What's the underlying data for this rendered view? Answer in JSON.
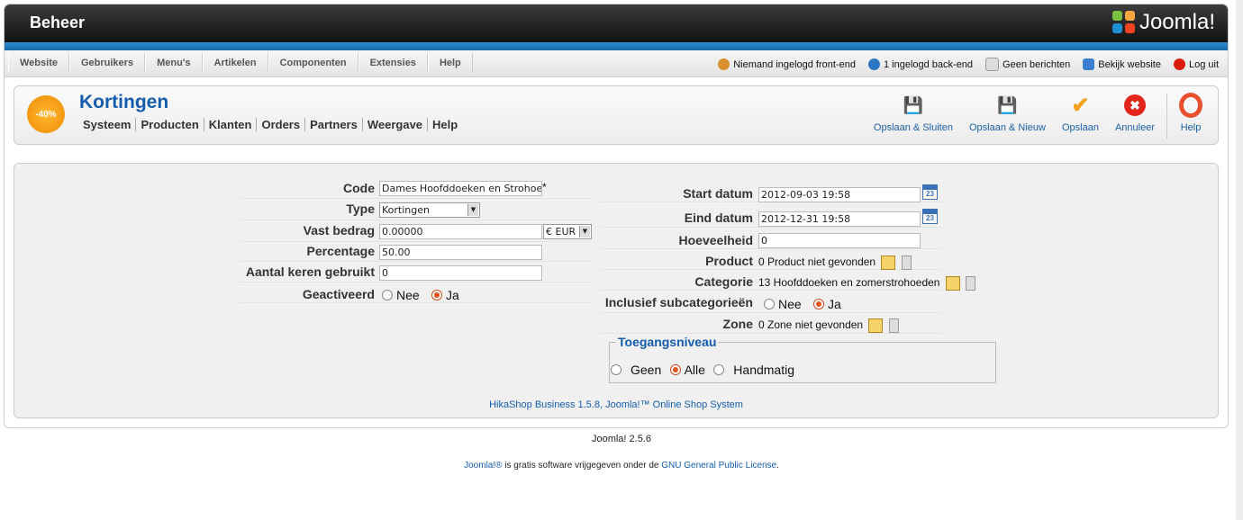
{
  "header": {
    "title": "Beheer",
    "logo_text": "Joomla!"
  },
  "menu": [
    "Website",
    "Gebruikers",
    "Menu's",
    "Artikelen",
    "Componenten",
    "Extensies",
    "Help"
  ],
  "status": {
    "frontend": "Niemand ingelogd front-end",
    "backend": "1 ingelogd back-end",
    "messages": "Geen berichten",
    "view_site": "Bekijk website",
    "logout": "Log uit"
  },
  "component": {
    "badge": "-40%",
    "title": "Kortingen",
    "submenu": [
      "Systeem",
      "Producten",
      "Klanten",
      "Orders",
      "Partners",
      "Weergave",
      "Help"
    ]
  },
  "toolbar": {
    "save_close": "Opslaan & Sluiten",
    "save_new": "Opslaan & Nieuw",
    "save": "Opslaan",
    "cancel": "Annuleer",
    "help": "Help"
  },
  "form_left": {
    "code_label": "Code",
    "code_value": "Dames Hoofddoeken en Strohoe",
    "code_required": "*",
    "type_label": "Type",
    "type_value": "Kortingen",
    "fixed_label": "Vast bedrag",
    "fixed_value": "0.00000",
    "currency": "€ EUR",
    "percent_label": "Percentage",
    "percent_value": "50.00",
    "used_label": "Aantal keren gebruikt",
    "used_value": "0",
    "active_label": "Geactiveerd",
    "no": "Nee",
    "yes": "Ja"
  },
  "form_right": {
    "start_label": "Start datum",
    "start_value": "2012-09-03 19:58",
    "end_label": "Eind datum",
    "end_value": "2012-12-31 19:58",
    "calendar_day": "23",
    "qty_label": "Hoeveelheid",
    "qty_value": "0",
    "product_label": "Product",
    "product_value": "0 Product niet gevonden",
    "category_label": "Categorie",
    "category_value": "13 Hoofddoeken en zomerstrohoeden",
    "subcat_label": "Inclusief subcategorieën",
    "no": "Nee",
    "yes": "Ja",
    "zone_label": "Zone",
    "zone_value": "0 Zone niet gevonden"
  },
  "access": {
    "legend": "Toegangsniveau",
    "none": "Geen",
    "all": "Alle",
    "manual": "Handmatig"
  },
  "credit": "HikaShop Business 1.5.8, Joomla!™ Online Shop System",
  "footer": {
    "version": "Joomla! 2.5.6",
    "license_link": "Joomla!®",
    "license_text": " is gratis software vrijgegeven onder de ",
    "license_name": "GNU General Public License",
    "license_end": "."
  },
  "colors": {
    "accent": "#135cae",
    "header_bar": "#1a6aa8",
    "active_radio": "#e2531f"
  }
}
